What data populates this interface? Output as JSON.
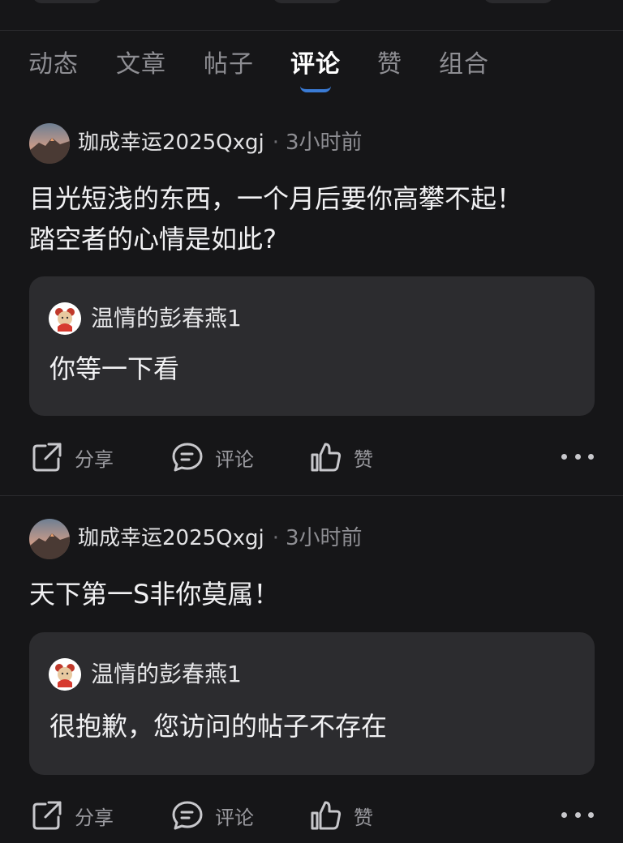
{
  "tabs": [
    {
      "label": "动态"
    },
    {
      "label": "文章"
    },
    {
      "label": "帖子"
    },
    {
      "label": "评论",
      "active": true
    },
    {
      "label": "赞"
    },
    {
      "label": "组合"
    }
  ],
  "accent_color": "#3a7bd5",
  "posts": [
    {
      "author": "珈成幸运2025Qxgj",
      "separator": "·",
      "time": "3小时前",
      "content_line1": "目光短浅的东西，一个月后要你高攀不起！",
      "content_line2": "踏空者的心情是如此?",
      "quote": {
        "author": "温情的彭春燕1",
        "text": "你等一下看"
      },
      "actions": {
        "share": "分享",
        "comment": "评论",
        "like": "赞"
      }
    },
    {
      "author": "珈成幸运2025Qxgj",
      "separator": "·",
      "time": "3小时前",
      "content_line1": "天下第一S非你莫属！",
      "quote": {
        "author": "温情的彭春燕1",
        "text": "很抱歉，您访问的帖子不存在"
      },
      "actions": {
        "share": "分享",
        "comment": "评论",
        "like": "赞"
      }
    }
  ]
}
